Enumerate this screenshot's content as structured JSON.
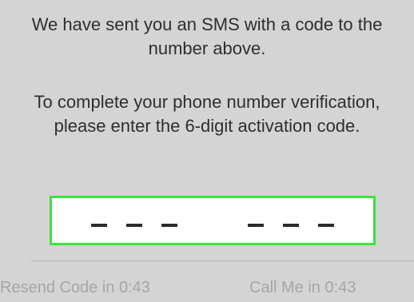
{
  "messages": {
    "sent": "We have sent you an SMS with a code to the number above.",
    "instructions": "To complete your phone number verification, please enter the 6-digit activation code."
  },
  "code_input": {
    "slots": [
      "-",
      "-",
      "-",
      "-",
      "-",
      "-"
    ],
    "digit_count": 6
  },
  "actions": {
    "resend_label": "Resend Code in 0:43",
    "call_label": "Call Me in 0:43"
  },
  "colors": {
    "background": "#d4d4d4",
    "input_border": "#3fe23f",
    "disabled_text": "#a6a6a6"
  }
}
